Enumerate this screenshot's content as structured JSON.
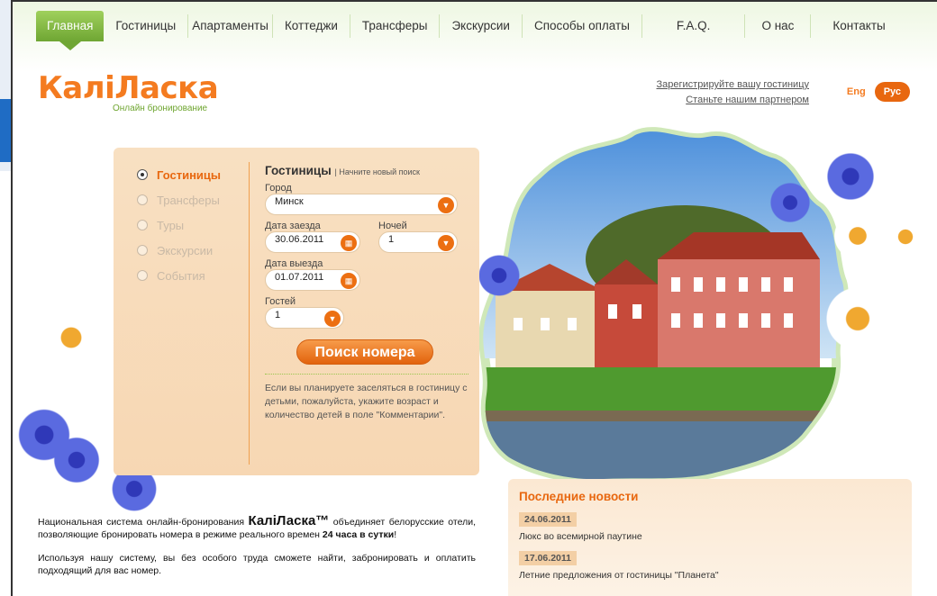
{
  "nav": {
    "items": [
      "Главная",
      "Гостиницы",
      "Апартаменты",
      "Коттеджи",
      "Трансферы",
      "Экскурсии",
      "Способы оплаты",
      "F.A.Q.",
      "О нас",
      "Контакты"
    ]
  },
  "logo": {
    "main": "КалiЛаска",
    "sub": "Онлайн бронирование"
  },
  "header_links": {
    "register": "Зарегистрируйте вашу гостиницу",
    "partner": "Станьте нашим партнером"
  },
  "lang": {
    "eng": "Eng",
    "rus": "Рус"
  },
  "search": {
    "types": [
      "Гостиницы",
      "Трансферы",
      "Туры",
      "Экскурсии",
      "События"
    ],
    "title": "Гостиницы",
    "new_search": "Начните новый поиск",
    "city_label": "Город",
    "city_value": "Минск",
    "checkin_label": "Дата заезда",
    "checkin_value": "30.06.2011",
    "nights_label": "Ночей",
    "nights_value": "1",
    "checkout_label": "Дата выезда",
    "checkout_value": "01.07.2011",
    "guests_label": "Гостей",
    "guests_value": "1",
    "submit": "Поиск номера",
    "note": "Если вы планируете заселяться в гостиницу с детьми, пожалуйста, укажите возраст и количество детей в поле \"Комментарии\"."
  },
  "intro": {
    "p1a": "Национальная система онлайн-бронирования",
    "brand": "КалiЛаска™",
    "p1b": "объединяет белорусские отели, позволяющие бронировать номера в режиме реального времен",
    "p1c": "24 часа в сутки",
    "p2": "Используя нашу систему, вы без особого труда сможете найти, забронировать и оплатить подходящий для вас номер."
  },
  "news": {
    "title": "Последние новости",
    "items": [
      {
        "date": "24.06.2011",
        "text": "Люкс во всемирной паутине"
      },
      {
        "date": "17.06.2011",
        "text": "Летние предложения от гостиницы \"Планета\""
      }
    ]
  }
}
